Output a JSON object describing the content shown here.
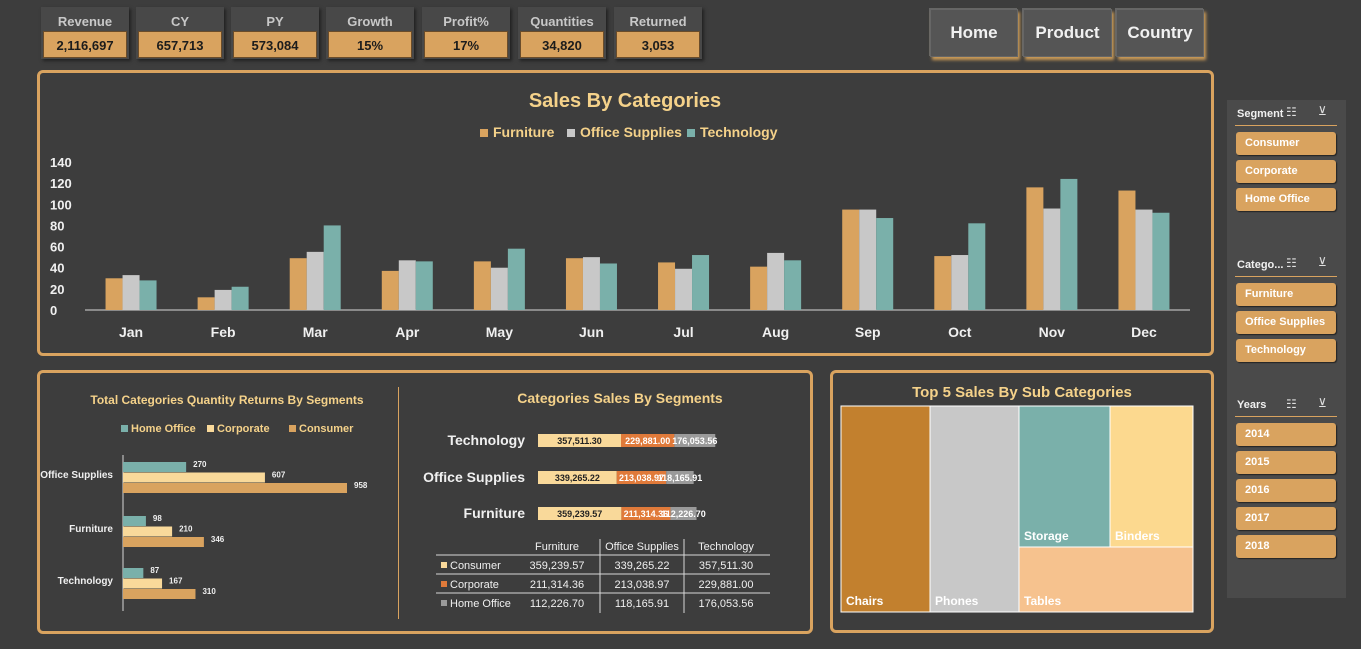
{
  "kpis": [
    {
      "label": "Revenue",
      "value": "2,116,697"
    },
    {
      "label": "CY",
      "value": "657,713"
    },
    {
      "label": "PY",
      "value": "573,084"
    },
    {
      "label": "Growth",
      "value": "15%"
    },
    {
      "label": "Profit%",
      "value": "17%"
    },
    {
      "label": "Quantities",
      "value": "34,820"
    },
    {
      "label": "Returned",
      "value": "3,053"
    }
  ],
  "nav": {
    "home": "Home",
    "product": "Product",
    "country": "Country"
  },
  "colors": {
    "furniture": "#d9a35f",
    "office": "#c8c8c8",
    "technology": "#7ab0aa",
    "consumer": "#f9d99a",
    "corporate": "#e07a3a",
    "home_office": "#9a9a9a",
    "accent": "#d9a35f"
  },
  "slicers": {
    "segment": {
      "title": "Segment",
      "items": [
        "Consumer",
        "Corporate",
        "Home Office"
      ]
    },
    "category": {
      "title": "Catego...",
      "items": [
        "Furniture",
        "Office Supplies",
        "Technology"
      ]
    },
    "years": {
      "title": "Years",
      "items": [
        "2014",
        "2015",
        "2016",
        "2017",
        "2018"
      ]
    }
  },
  "chart_data": [
    {
      "type": "bar",
      "title": "Sales By Categories",
      "categories": [
        "Jan",
        "Feb",
        "Mar",
        "Apr",
        "May",
        "Jun",
        "Jul",
        "Aug",
        "Sep",
        "Oct",
        "Nov",
        "Dec"
      ],
      "series": [
        {
          "name": "Furniture",
          "values": [
            30,
            12,
            49,
            37,
            46,
            49,
            45,
            41,
            95,
            51,
            116,
            113
          ]
        },
        {
          "name": "Office Supplies",
          "values": [
            33,
            19,
            55,
            47,
            40,
            50,
            39,
            54,
            95,
            52,
            96,
            95
          ]
        },
        {
          "name": "Technology",
          "values": [
            28,
            22,
            80,
            46,
            58,
            44,
            52,
            47,
            87,
            82,
            124,
            92
          ]
        }
      ],
      "ylim": [
        0,
        140
      ],
      "yticks": [
        "0",
        "20",
        "40",
        "60",
        "80",
        "100",
        "120",
        "140"
      ],
      "legend": "top"
    },
    {
      "type": "bar",
      "orientation": "horizontal",
      "title": "Total Categories Quantity Returns By Segments",
      "categories": [
        "Office Supplies",
        "Furniture",
        "Technology"
      ],
      "series": [
        {
          "name": "Home Office",
          "values": [
            270,
            98,
            87
          ]
        },
        {
          "name": "Corporate",
          "values": [
            607,
            210,
            167
          ]
        },
        {
          "name": "Consumer",
          "values": [
            958,
            346,
            310
          ]
        }
      ],
      "legend": "top"
    },
    {
      "type": "bar",
      "orientation": "horizontal",
      "stacked": true,
      "title": "Categories Sales By Segments",
      "categories": [
        "Technology",
        "Office Supplies",
        "Furniture"
      ],
      "series": [
        {
          "name": "Consumer",
          "values": [
            357511.3,
            339265.22,
            359239.57
          ],
          "labels": [
            "357,511.30",
            "339,265.22",
            "359,239.57"
          ]
        },
        {
          "name": "Corporate",
          "values": [
            229881.0,
            213038.97,
            211314.36
          ],
          "labels": [
            "229,881.00",
            "213,038.97",
            "211,314.36"
          ]
        },
        {
          "name": "Home Office",
          "values": [
            176053.56,
            118165.91,
            112226.7
          ],
          "labels": [
            "176,053.56",
            "118,165.91",
            "112,226.70"
          ]
        }
      ],
      "bar_labels": [
        [
          "357,511.30",
          "229,881.00",
          "176,053.56"
        ],
        [
          "339,265.22",
          "213,038.97",
          "118,165.91"
        ],
        [
          "359,239.57",
          "211,314.36",
          "112,226.70"
        ]
      ],
      "table": {
        "headers": [
          "Furniture",
          "Office Supplies",
          "Technology"
        ],
        "rows": [
          {
            "name": "Consumer",
            "cells": [
              "359,239.57",
              "339,265.22",
              "357,511.30"
            ]
          },
          {
            "name": "Corporate",
            "cells": [
              "211,314.36",
              "213,038.97",
              "229,881.00"
            ]
          },
          {
            "name": "Home Office",
            "cells": [
              "112,226.70",
              "118,165.91",
              "176,053.56"
            ]
          }
        ]
      }
    },
    {
      "type": "treemap",
      "title": "Top 5 Sales By Sub Categories",
      "items": [
        {
          "name": "Chairs",
          "color": "#c2802e"
        },
        {
          "name": "Phones",
          "color": "#c8c8c8"
        },
        {
          "name": "Storage",
          "color": "#7ab0aa"
        },
        {
          "name": "Binders",
          "color": "#fcd98f"
        },
        {
          "name": "Tables",
          "color": "#f6c28e"
        }
      ]
    }
  ]
}
